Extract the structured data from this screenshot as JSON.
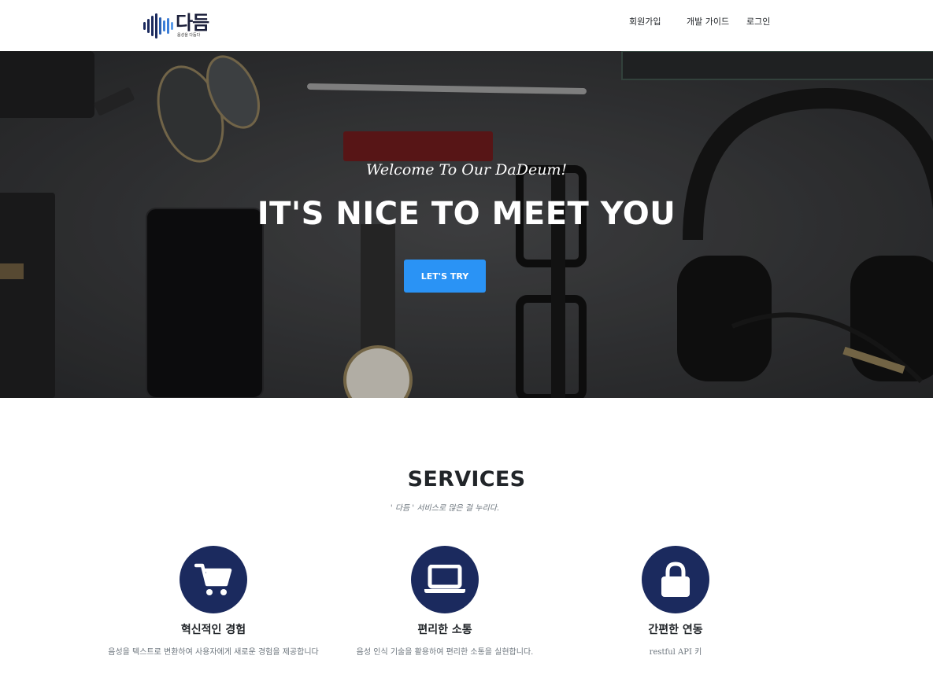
{
  "brand": {
    "name": "다듬",
    "tagline": "음성을 다듬다",
    "colors": {
      "wave_dark": "#1b2a5e",
      "wave_light": "#3d7ed8"
    }
  },
  "nav": {
    "items": [
      {
        "label": "회원가입"
      },
      {
        "label": "개발 가이드"
      },
      {
        "label": "로그인"
      }
    ]
  },
  "hero": {
    "subtitle": "Welcome To Our DaDeum!",
    "title": "IT'S NICE TO MEET YOU",
    "button_label": "LET'S TRY",
    "colors": {
      "button": "#2a93f5"
    }
  },
  "services": {
    "heading": "SERVICES",
    "subheading": "' 다듬 ' 서비스로 많은 걸 누리다.",
    "colors": {
      "icon_bg": "#1b2a5e"
    },
    "items": [
      {
        "icon": "shopping-cart-icon",
        "title": "혁신적인 경험",
        "description": "음성을 텍스트로 변환하여 사용자에게 새로운 경험을 제공합니다"
      },
      {
        "icon": "laptop-icon",
        "title": "편리한 소통",
        "description": "음성 인식 기술을 활용하여 편리한 소통을 실현합니다."
      },
      {
        "icon": "lock-icon",
        "title": "간편한 연동",
        "description": "restful API 키"
      }
    ]
  }
}
